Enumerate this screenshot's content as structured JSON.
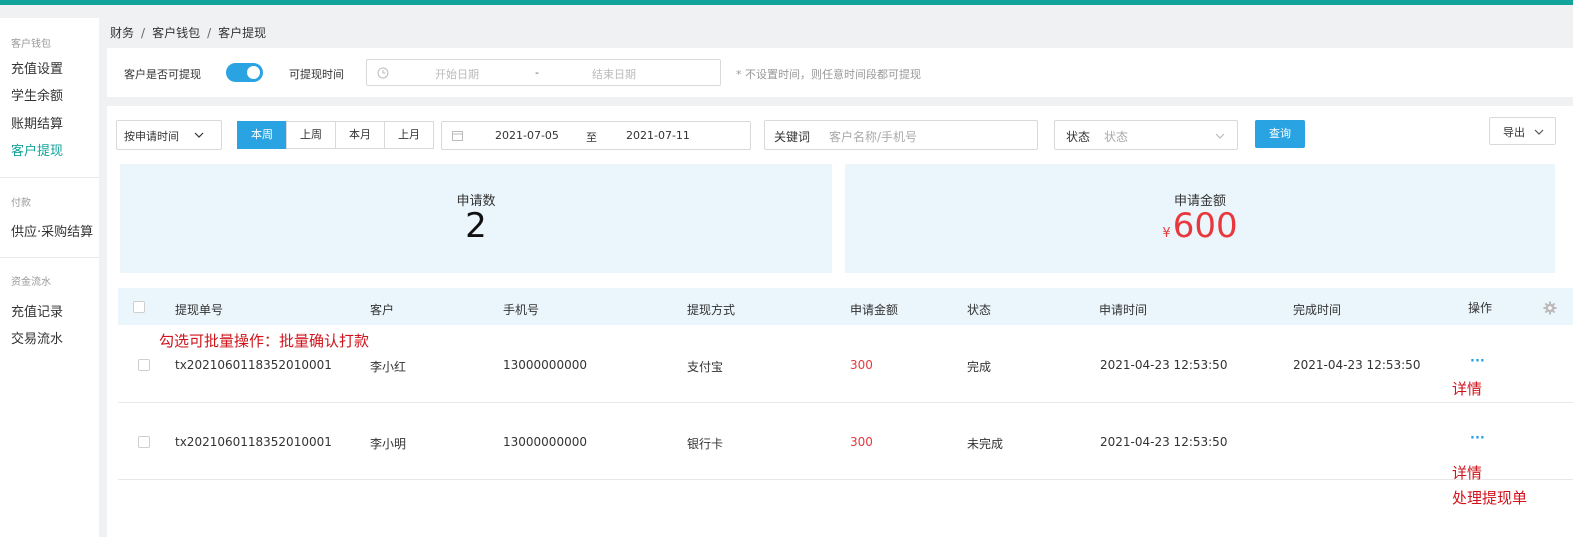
{
  "sidebar": {
    "groups": {
      "wallet": "客户钱包",
      "payment": "付款",
      "funds": "资金流水"
    },
    "items": {
      "recharge_settings": "充值设置",
      "student_balance": "学生余额",
      "billing_settlement": "账期结算",
      "customer_withdraw": "客户提现",
      "supply_settlement": "供应·采购结算",
      "recharge_records": "充值记录",
      "transaction_flow": "交易流水"
    }
  },
  "breadcrumb": [
    "财务",
    "客户钱包",
    "客户提现"
  ],
  "settings": {
    "allow_withdraw_label": "客户是否可提现",
    "withdraw_time_label": "可提现时间",
    "start_placeholder": "开始日期",
    "range_dash": "-",
    "end_placeholder": "结束日期",
    "hint": "* 不设置时间，则任意时间段都可提现",
    "toggle_on": true
  },
  "filters": {
    "time_type": "按申请时间",
    "period_tabs": [
      "本周",
      "上周",
      "本月",
      "上月"
    ],
    "active_tab": "本周",
    "date_from": "2021-07-05",
    "date_to_label": "至",
    "date_to": "2021-07-11",
    "keyword_label": "关键词",
    "keyword_placeholder": "客户名称/手机号",
    "status_label": "状态",
    "status_placeholder": "状态",
    "query_button": "查询",
    "export_button": "导出"
  },
  "stats": {
    "count_label": "申请数",
    "count_value": "2",
    "amount_label": "申请金额",
    "currency": "¥",
    "amount_value": "600"
  },
  "table": {
    "headers": [
      "提现单号",
      "客户",
      "手机号",
      "提现方式",
      "申请金额",
      "状态",
      "申请时间",
      "完成时间",
      "操作"
    ],
    "rows": [
      {
        "id": "tx2021060118352010001",
        "customer": "李小红",
        "phone": "13000000000",
        "method": "支付宝",
        "amount": "300",
        "status": "完成",
        "apply_time": "2021-04-23 12:53:50",
        "finish_time": "2021-04-23 12:53:50",
        "action": "···"
      },
      {
        "id": "tx2021060118352010001",
        "customer": "李小明",
        "phone": "13000000000",
        "method": "银行卡",
        "amount": "300",
        "status": "未完成",
        "apply_time": "2021-04-23 12:53:50",
        "finish_time": "",
        "action": "···"
      }
    ]
  },
  "annotations": {
    "batch_hint": "勾选可批量操作：批量确认打款",
    "row1_detail": "详情",
    "row2_detail": "详情",
    "row2_process": "处理提现单"
  },
  "colors": {
    "accent": "#2aa3e3",
    "brand": "#12a39a",
    "money": "#e8383d",
    "annotation": "#d0131b"
  },
  "icons": {
    "clock": "clock-icon",
    "calendar": "calendar-icon",
    "chevron": "chevron-down-icon",
    "settings": "gear-icon"
  }
}
